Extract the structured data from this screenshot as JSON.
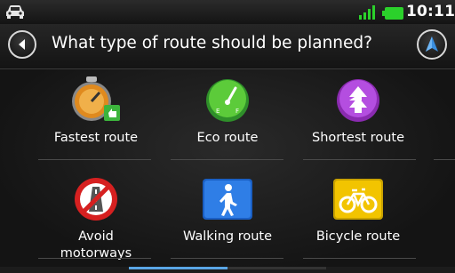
{
  "status_bar": {
    "time": "10:11",
    "icons": [
      "car-icon",
      "signal-icon",
      "battery-icon"
    ],
    "battery_color": "#2bd12b"
  },
  "header": {
    "title": "What type of route should be planned?",
    "back_icon": "back-arrow-icon",
    "nav_icon": "navigation-arrow-icon"
  },
  "options": [
    {
      "label": "Fastest route",
      "icon": "stopwatch-icon"
    },
    {
      "label": "Eco route",
      "icon": "fuel-gauge-icon"
    },
    {
      "label": "Shortest route",
      "icon": "shortest-arrows-icon"
    },
    {
      "label": "Avoid\nmotorways",
      "icon": "no-motorway-icon"
    },
    {
      "label": "Walking route",
      "icon": "pedestrian-icon"
    },
    {
      "label": "Bicycle route",
      "icon": "bicycle-icon"
    }
  ],
  "scroll_position": 0.5
}
